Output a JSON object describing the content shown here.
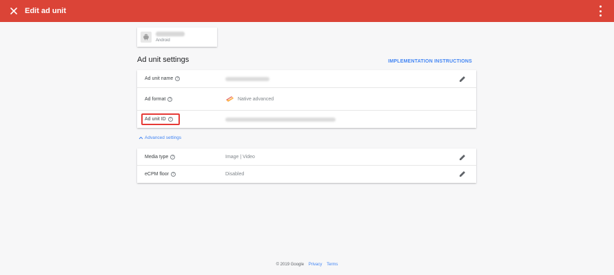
{
  "topbar": {
    "title": "Edit ad unit",
    "close_icon": "close-icon",
    "more_icon": "more-vert-icon",
    "color": "#db4437"
  },
  "app": {
    "platform": "Android",
    "icon": "android-icon"
  },
  "section": {
    "title": "Ad unit settings",
    "implementation_link": "IMPLEMENTATION INSTRUCTIONS"
  },
  "settings": {
    "ad_unit_name_label": "Ad unit name",
    "ad_format_label": "Ad format",
    "ad_format_value": "Native advanced",
    "ad_unit_id_label": "Ad unit ID"
  },
  "advanced": {
    "toggle_label": "Advanced settings",
    "media_type_label": "Media type",
    "media_type_value": "Image | Video",
    "ecpm_label": "eCPM floor",
    "ecpm_value": "Disabled"
  },
  "footer": {
    "copyright": "© 2019 Google",
    "privacy": "Privacy",
    "terms": "Terms"
  },
  "colors": {
    "accent": "#4285f4",
    "highlight": "#e53935"
  }
}
